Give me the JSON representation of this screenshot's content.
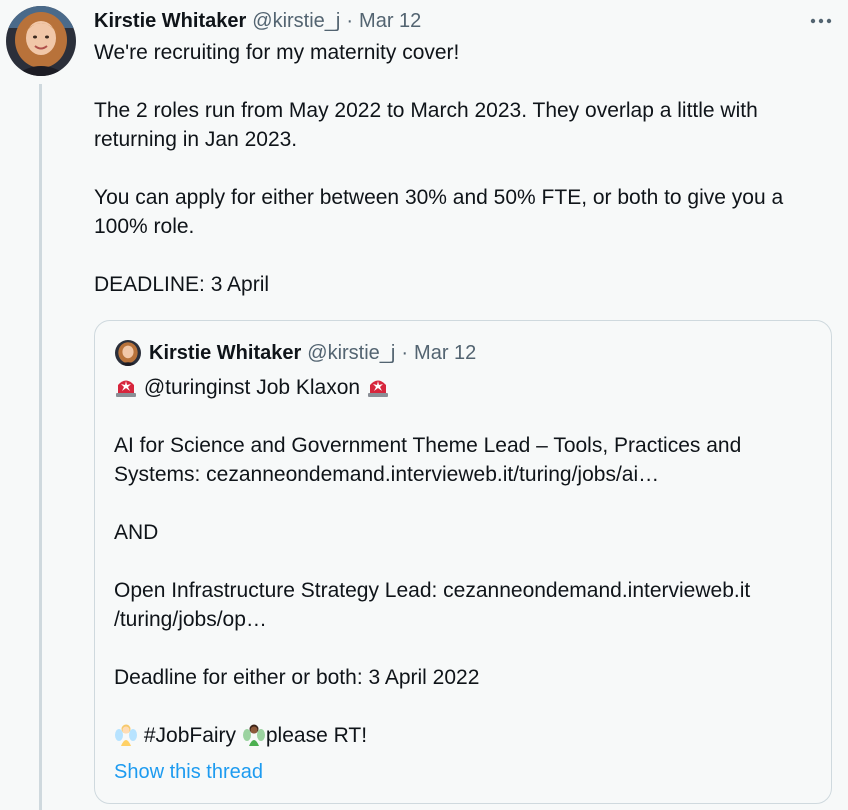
{
  "tweet": {
    "author_name": "Kirstie Whitaker",
    "author_handle": "@kirstie_j",
    "separator": "·",
    "date": "Mar 12",
    "more_icon": "more-horizontal-icon",
    "paragraphs": [
      "We're recruiting for my maternity cover!",
      "The 2 roles run from May 2022 to March 2023. They overlap a little with returning in Jan 2023.",
      "You can apply for either between 30% and 50% FTE, or both to give you a 100% role.",
      "DEADLINE: 3 April"
    ]
  },
  "quoted": {
    "author_name": "Kirstie Whitaker",
    "author_handle": "@kirstie_j",
    "separator": "·",
    "date": "Mar 12",
    "line1_text": " @turinginst Job Klaxon ",
    "line1_icon": "police-siren-emoji",
    "role1": "AI for Science and Government Theme Lead – Tools, Practices and Systems: cezanneondemand.intervieweb.it/turing/jobs/ai…",
    "and": "AND",
    "role2": "Open Infrastructure Strategy Lead: cezanneondemand.intervieweb.it /turing/jobs/op…",
    "deadline": "Deadline for either or both: 3 April 2022",
    "hashtag": " #JobFairy ",
    "rt": "please RT!",
    "fairy_icon_1": "fairy-emoji",
    "fairy_icon_2": "man-fairy-emoji",
    "show_thread": "Show this thread"
  },
  "colors": {
    "background": "#f7f9f9",
    "text": "#0f1419",
    "muted": "#536471",
    "link": "#1d9bf0",
    "border": "#cfd9de"
  }
}
